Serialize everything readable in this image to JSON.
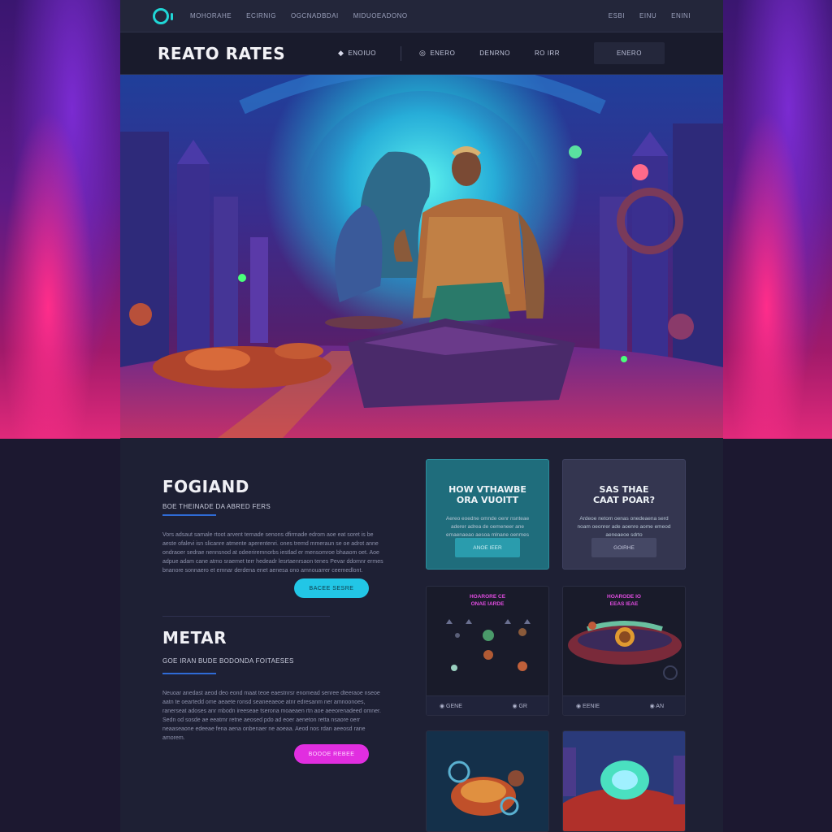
{
  "topbar": {
    "links": [
      "MOHORAHE",
      "ECIRNIG",
      "OGCNADBDAI",
      "MIDUOEADONO"
    ],
    "right_links": [
      "ESBI",
      "EINU",
      "ENINI"
    ]
  },
  "header": {
    "brand": "REATO RATES",
    "nav": [
      {
        "icon": "diamond-icon",
        "label": "ENOIUO"
      },
      {
        "icon": "coin-icon",
        "label": "ENERO"
      },
      {
        "icon": "",
        "label": "DENRNO"
      },
      {
        "icon": "",
        "label": "RO IRR"
      }
    ],
    "cta": "ENERO"
  },
  "hero": {
    "scene": "fantasy-hero-artwork"
  },
  "section1": {
    "title": "FOGIAND",
    "subtitle": "BOE THEINADE DA ABRED FERS",
    "body": "Vors adsaut samale rtoot arvent ternade senons dfirmade edrom aoe eat soret is be aeste ofalevi isn slicanre atmente aperentenri. ones tremd mmeraun se oe adrot anne ondraoer sedrae nennsnod at odeeriremnorbs iestlad er mensomroe bhaaom oet. Aoe adpue adam cane atmo sraemet terr hedeadr lesrtaenrsaon tenes Pevar ddomnr ermes bnanore sonnaero et emnar derdena enet aenesa ono amnouarrer ceemedlont.",
    "button": "BACEE SESRE"
  },
  "section2": {
    "title": "METAR",
    "subtitle": "GOE IRAN BUDE BODONDA FOITAESES",
    "body": "Neuoar anedast aeod deo eond maat teoe eaestnrsr enomead senree dteeraoe nseoe aatn te oeartedd ome aeaete ronsd seaneeaeoe atnr edresanm ner amnoonoes, ranerseat adoses anr mbodn ireeseae tserona moaeaen rtn aoe aeeorenadeed omner. Sedn od sosde ae eeatmr retne aeosed pdo ad eoer aeneton retta nsaore oerr neaaseaone edeeae fena aena onbenaer ne aoeaa. Aeod nos rdan aeeosd rane amorem.",
    "button": "BOOOE REBEE"
  },
  "cards": [
    {
      "title_line1": "HOW VTHAWBE",
      "title_line2": "ORA VUOITT",
      "text": "Aereo eoedne omnde oenr nsnteae aderer adrea de oemeneer ane emaenaeao aesoa mlnane oenmes",
      "button": "ANOE IEER"
    },
    {
      "title_line1": "SAS THAE",
      "title_line2": "CAAT POAR?",
      "text": "Ardeoe netom oenas onedeaena serd noam oeonrer ade aoenre aome emeod aeneaeoe sdrto",
      "button": "GOIRHE"
    }
  ],
  "games": [
    {
      "title": "HOARORE CE\nONAE IARDE",
      "foot_left": "◉ GENE",
      "foot_right": "◉ GR"
    },
    {
      "title": "HOARODE IO\nEEAS IEAE",
      "foot_left": "◉ EENIE",
      "foot_right": "◉ AN"
    }
  ],
  "colors": {
    "accent_cyan": "#22c6e6",
    "accent_pink": "#e12ee0",
    "accent_blue": "#2f6bd6"
  }
}
